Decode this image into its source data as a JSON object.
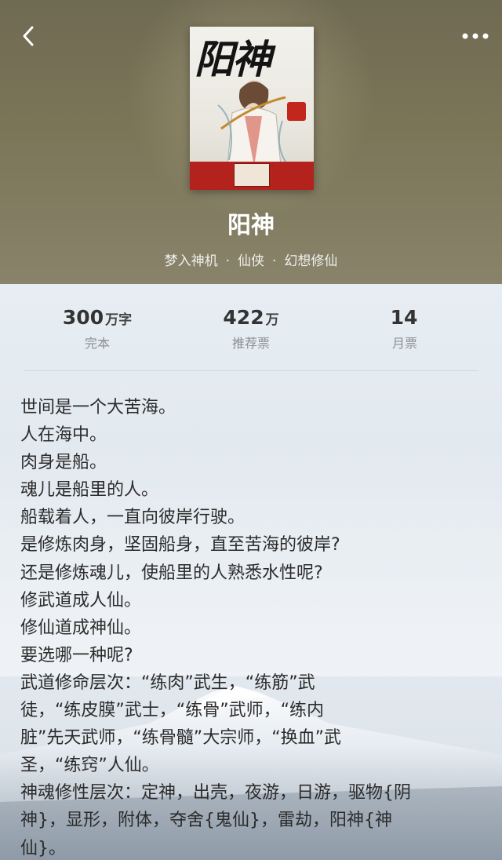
{
  "book": {
    "title": "阳神",
    "author": "梦入神机",
    "category": "仙侠",
    "subcategory": "幻想修仙",
    "separator": "·"
  },
  "cover": {
    "title_art": "阳神"
  },
  "stats": [
    {
      "value": "300",
      "unit": "万字",
      "label": "完本"
    },
    {
      "value": "422",
      "unit": "万",
      "label": "推荐票"
    },
    {
      "value": "14",
      "unit": "",
      "label": "月票"
    }
  ],
  "synopsis": [
    "世间是一个大苦海。",
    "人在海中。",
    "肉身是船。",
    "魂儿是船里的人。",
    "船载着人，一直向彼岸行驶。",
    "是修炼肉身，坚固船身，直至苦海的彼岸?",
    "还是修炼魂儿，使船里的人熟悉水性呢?",
    "修武道成人仙。",
    "修仙道成神仙。",
    "要选哪一种呢?",
    "武道修命层次：“练肉”武生，“练筋”武",
    "徒，“练皮膜”武士，“练骨”武师，“练内",
    "脏”先天武师，“练骨髓”大宗师，“换血”武",
    "圣，“练窍”人仙。",
    "神魂修性层次：定神，出壳，夜游，日游，驱物{阴",
    "神}，显形，附体，夺舍{鬼仙}，雷劫，阳神{神",
    "仙}。"
  ],
  "icons": {
    "back": "back-chevron-icon",
    "more": "more-dots-icon"
  },
  "colors": {
    "header_bg": "#7b7558",
    "content_bg": "#e4eaf0",
    "text": "#2b2b2b",
    "muted": "#8a8f96"
  }
}
